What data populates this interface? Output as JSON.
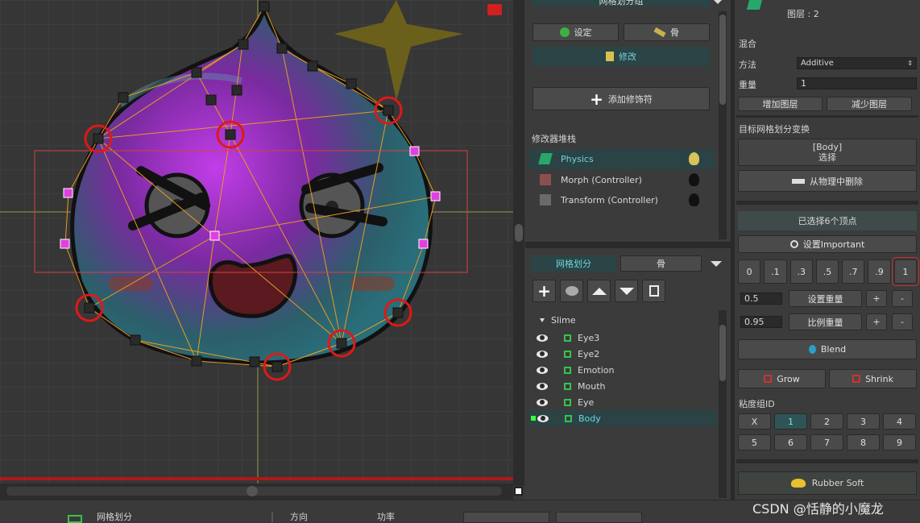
{
  "viewport": {
    "lock_icon": "lock-icon"
  },
  "mid": {
    "top_tab": "网格划分组",
    "settings_label": "设定",
    "bone_label": "骨",
    "modify_label": "修改",
    "add_modifier_label": "添加修饰符",
    "stack_title": "修改器堆栈",
    "modifiers": [
      {
        "label": "Physics"
      },
      {
        "label": "Morph (Controller)"
      },
      {
        "label": "Transform (Controller)"
      }
    ],
    "mesh_tab": "网格划分",
    "bone_tab": "骨",
    "tree_root": "Slime",
    "tree_items": [
      {
        "label": "Eye3"
      },
      {
        "label": "Eye2"
      },
      {
        "label": "Emotion"
      },
      {
        "label": "Mouth"
      },
      {
        "label": "Eye"
      },
      {
        "label": "Body"
      }
    ]
  },
  "right": {
    "layer_label": "图层 : 2",
    "blend_title": "混合",
    "method_label": "方法",
    "method_value": "Additive",
    "weight_label": "重量",
    "weight_value": "1",
    "add_layer": "增加图层",
    "remove_layer": "减少图层",
    "target_title": "目标网格划分变换",
    "target_name": "[Body]",
    "target_select": "选择",
    "remove_physics": "从物理中删除",
    "selected_info": "已选择6个顶点",
    "set_important": "设置Important",
    "weights": [
      "0",
      ".1",
      ".3",
      ".5",
      ".7",
      ".9",
      "1"
    ],
    "set_weight_value": "0.5",
    "set_weight_label": "设置重量",
    "ratio_weight_value": "0.95",
    "ratio_weight_label": "比例重量",
    "plus": "+",
    "minus": "-",
    "blend_btn": "Blend",
    "grow_btn": "Grow",
    "shrink_btn": "Shrink",
    "sticky_title": "粘度组ID",
    "sticky_ids": [
      "X",
      "1",
      "2",
      "3",
      "4",
      "5",
      "6",
      "7",
      "8",
      "9"
    ],
    "rubber_btn": "Rubber Soft"
  },
  "bottom": {
    "mesh_label": "网格划分",
    "dir_label": "方向",
    "func_label": "功率"
  },
  "watermark": "CSDN @恬静的小魔龙"
}
